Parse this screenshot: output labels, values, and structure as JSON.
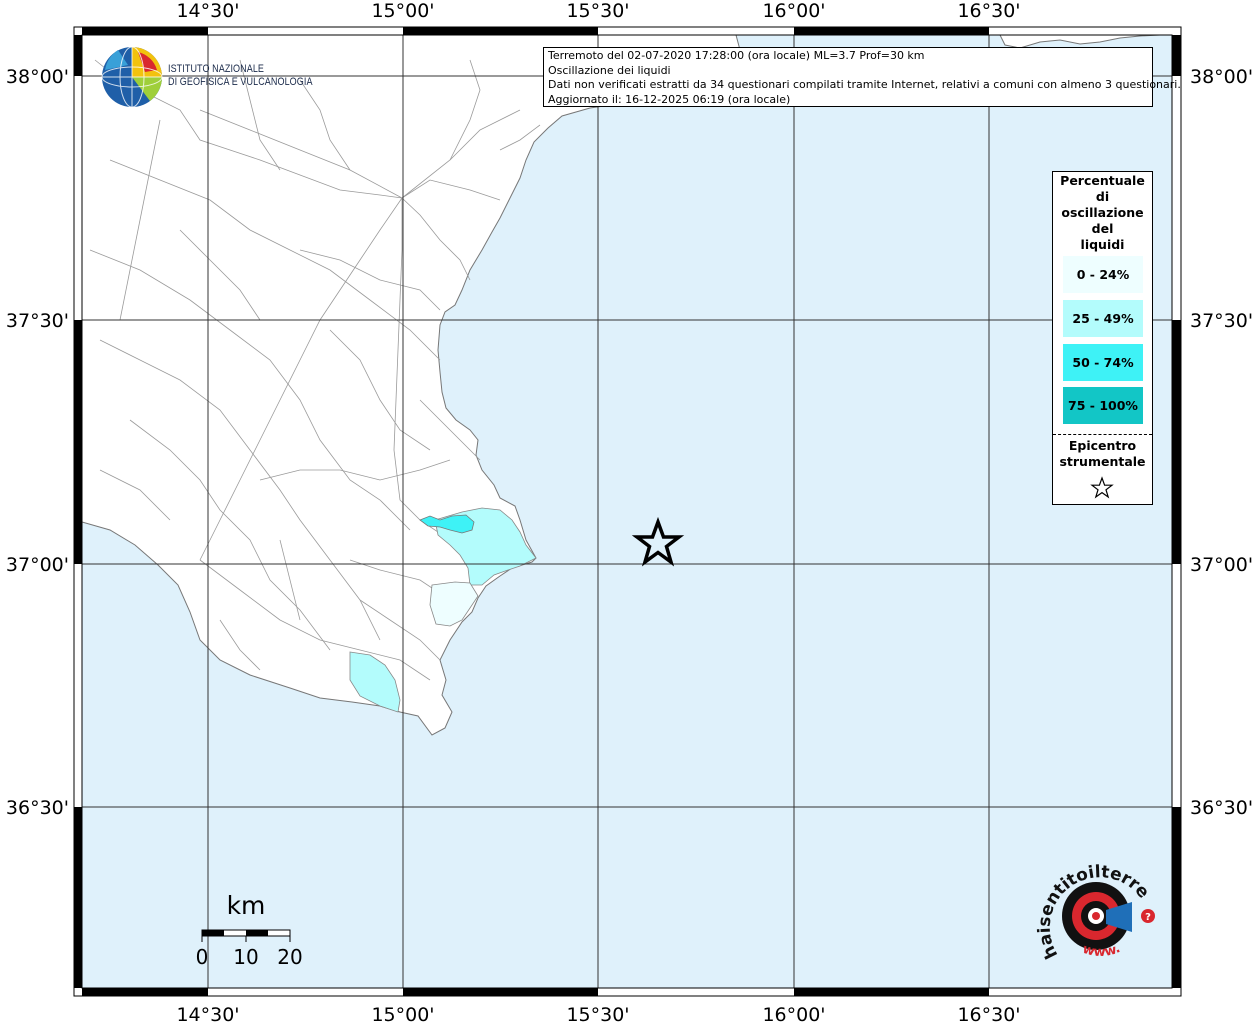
{
  "map": {
    "longitude_labels": [
      "14°30'",
      "15°00'",
      "15°30'",
      "16°00'",
      "16°30'"
    ],
    "latitude_labels": [
      "38°00'",
      "37°30'",
      "37°00'",
      "36°30'"
    ],
    "colors": {
      "sea": "#dff1fb",
      "land": "#ffffff",
      "frame": "#000000"
    }
  },
  "info": {
    "line1": "Terremoto del 02-07-2020 17:28:00 (ora locale) ML=3.7 Prof=30 km",
    "line2": "Oscillazione dei liquidi",
    "line3": "Dati non verificati estratti da 34 questionari compilati tramite Internet, relativi a comuni con almeno 3 questionari.",
    "line4": "Aggiornato il: 16-12-2025 06:19 (ora locale)"
  },
  "institute": {
    "line1": "ISTITUTO NAZIONALE",
    "line2": "DI GEOFISICA E VULCANOLOGIA"
  },
  "legend": {
    "title_lines": [
      "Percentuale",
      "di",
      "oscillazione",
      "del",
      "liquidi"
    ],
    "items": [
      {
        "label": "0 - 24%",
        "color": "#eefeff"
      },
      {
        "label": "25 - 49%",
        "color": "#b3fcfc"
      },
      {
        "label": "50 - 74%",
        "color": "#3ef2f6"
      },
      {
        "label": "75 - 100%",
        "color": "#12c6c6"
      }
    ],
    "epicenter_lines": [
      "Epicentro",
      "strumentale"
    ],
    "epicenter_icon": "star-outline-icon"
  },
  "scale": {
    "unit": "km",
    "ticks": [
      "0",
      "10",
      "20"
    ]
  },
  "brand": {
    "text": "haisentitoilterremoto.it",
    "prefix": "www."
  }
}
